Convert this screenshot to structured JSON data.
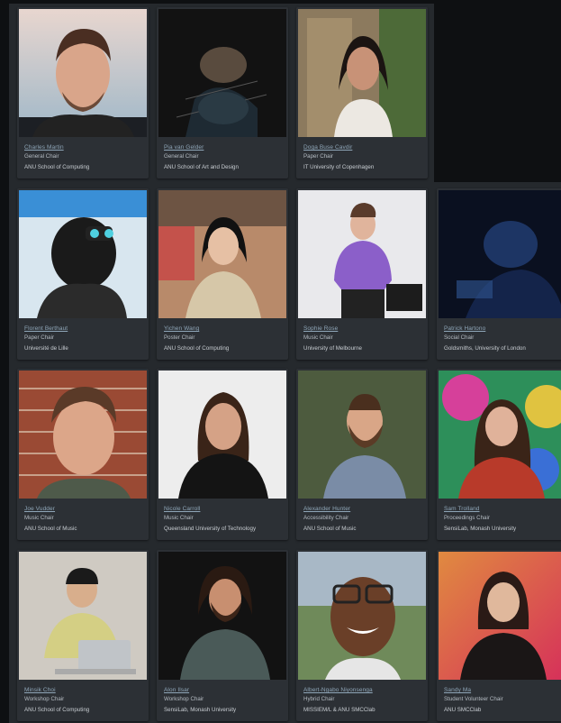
{
  "people": [
    {
      "name": "Charles Martin",
      "role": "General Chair",
      "affiliation": "ANU School of Computing",
      "photo_icon": "portrait-photo"
    },
    {
      "name": "Pia van Gelder",
      "role": "General Chair",
      "affiliation": "ANU School of Art and Design",
      "photo_icon": "portrait-photo"
    },
    {
      "name": "Doga Buse Cavdir",
      "role": "Paper Chair",
      "affiliation": "IT University of Copenhagen",
      "photo_icon": "portrait-photo"
    },
    {
      "name": "Florent Berthaut",
      "role": "Paper Chair",
      "affiliation": "Université de Lille",
      "photo_icon": "portrait-photo"
    },
    {
      "name": "Yichen Wang",
      "role": "Poster Chair",
      "affiliation": "ANU School of Computing",
      "photo_icon": "portrait-photo"
    },
    {
      "name": "Sophie Rose",
      "role": "Music Chair",
      "affiliation": "University of Melbourne",
      "photo_icon": "portrait-photo"
    },
    {
      "name": "Patrick Hartono",
      "role": "Social Chair",
      "affiliation": "Goldsmiths, University of London",
      "photo_icon": "portrait-photo"
    },
    {
      "name": "Joe Vudder",
      "role": "Music Chair",
      "affiliation": "ANU School of Music",
      "photo_icon": "portrait-photo"
    },
    {
      "name": "Nicole Carroll",
      "role": "Music Chair",
      "affiliation": "Queensland University of Technology",
      "photo_icon": "portrait-photo"
    },
    {
      "name": "Alexander Hunter",
      "role": "Accessibility Chair",
      "affiliation": "ANU School of Music",
      "photo_icon": "portrait-photo"
    },
    {
      "name": "Sam Trolland",
      "role": "Proceedings Chair",
      "affiliation": "SensiLab, Monash University",
      "photo_icon": "portrait-photo"
    },
    {
      "name": "Minsik Choi",
      "role": "Workshop Chair",
      "affiliation": "ANU School of Computing",
      "photo_icon": "portrait-photo"
    },
    {
      "name": "Alon Ilsar",
      "role": "Workshop Chair",
      "affiliation": "SensiLab, Monash University",
      "photo_icon": "portrait-photo"
    },
    {
      "name": "Albert-Ngabo Niyonsenga",
      "role": "Hybrid Chair",
      "affiliation": "MISSIEM/L & ANU SMCClab",
      "photo_icon": "portrait-photo"
    },
    {
      "name": "Sandy Ma",
      "role": "Student Volunteer Chair",
      "affiliation": "ANU SMCClab",
      "photo_icon": "portrait-photo"
    }
  ],
  "colors": {
    "page_background": "#0e1012",
    "panel_background": "#25292d",
    "card_background": "#2c3035",
    "name_link": "#8fa6b8",
    "role_text": "#b5bcc3"
  }
}
